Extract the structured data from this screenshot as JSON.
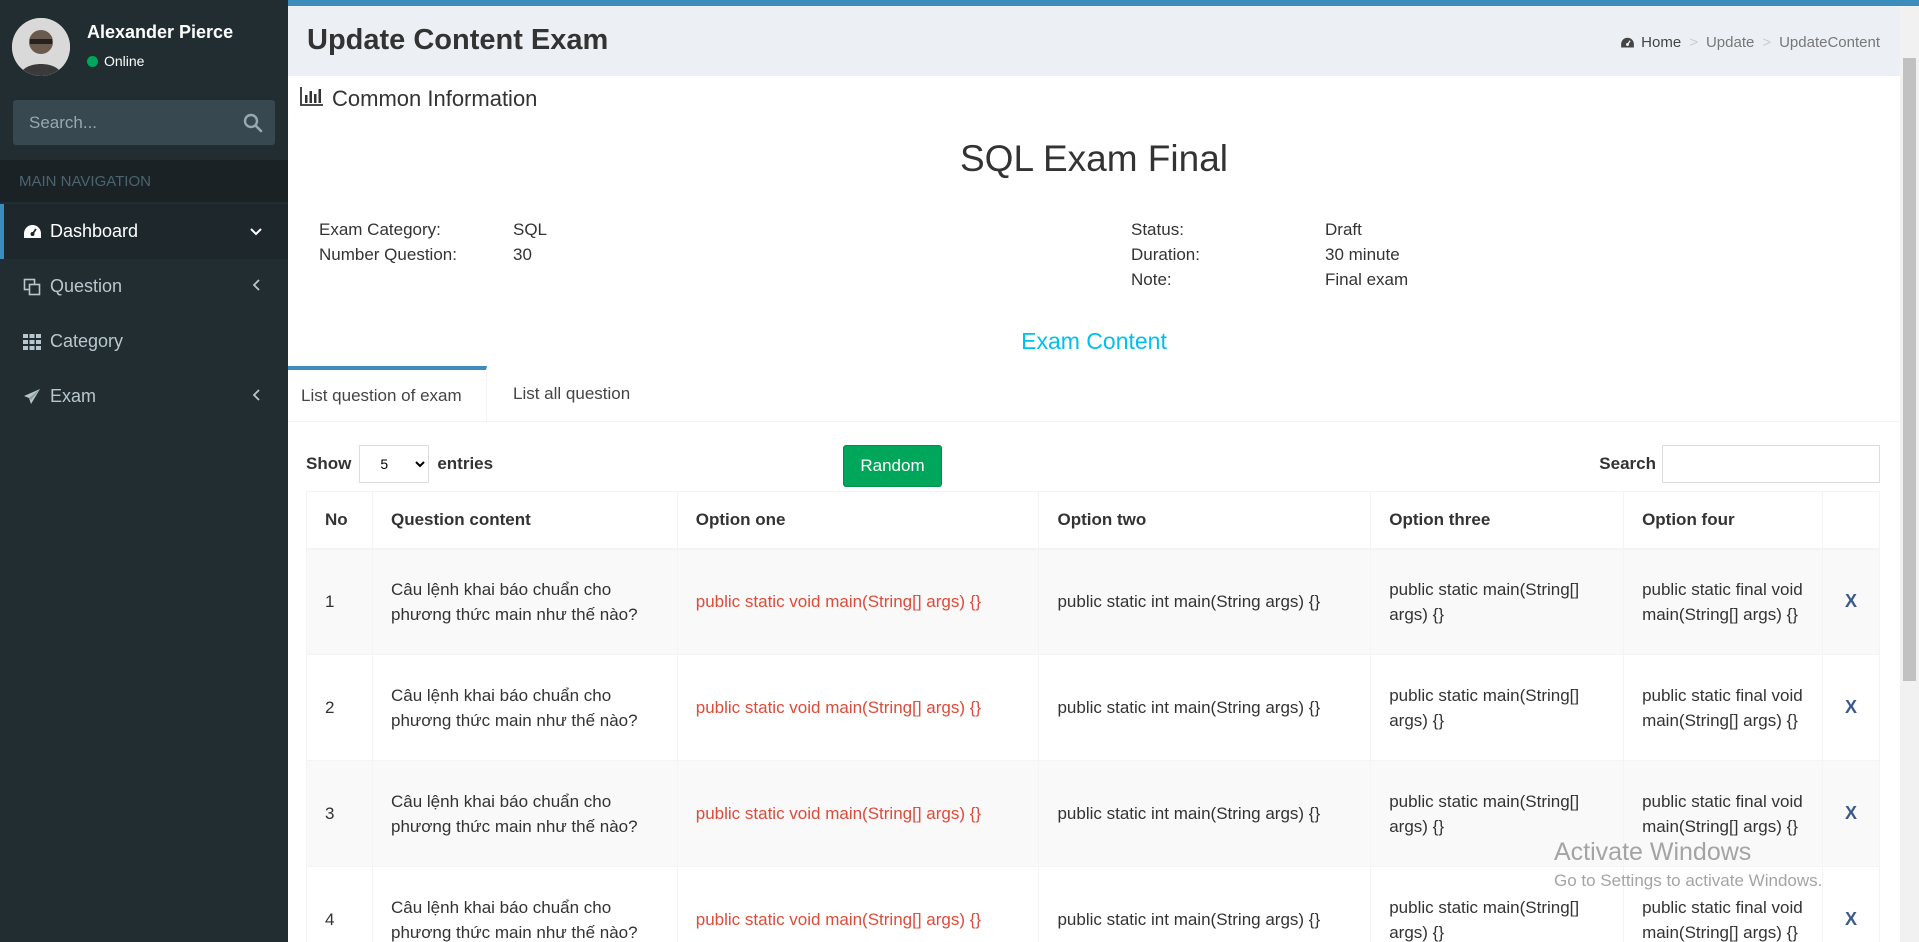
{
  "sidebar": {
    "user_name": "Alexander Pierce",
    "user_status": "Online",
    "search_placeholder": "Search...",
    "nav_header": "MAIN NAVIGATION",
    "items": [
      {
        "label": "Dashboard",
        "icon": "dashboard-icon",
        "arrow": "chevron-down"
      },
      {
        "label": "Question",
        "icon": "copy-icon",
        "arrow": "chevron-left"
      },
      {
        "label": "Category",
        "icon": "grid-icon",
        "arrow": ""
      },
      {
        "label": "Exam",
        "icon": "paper-plane-icon",
        "arrow": "chevron-left"
      }
    ]
  },
  "header": {
    "title": "Update Content Exam",
    "breadcrumb": [
      "Home",
      "Update",
      "UpdateContent"
    ]
  },
  "box": {
    "title": "Common Information",
    "exam_title": "SQL Exam Final",
    "left_info": [
      {
        "key": "Exam Category:",
        "value": "SQL"
      },
      {
        "key": "Number Question:",
        "value": "30"
      }
    ],
    "right_info": [
      {
        "key": "Status:",
        "value": "Draft"
      },
      {
        "key": "Duration:",
        "value": "30 minute"
      },
      {
        "key": "Note:",
        "value": "Final exam"
      }
    ],
    "section_title": "Exam Content",
    "tabs": [
      "List question of exam",
      "List all question"
    ]
  },
  "datatable": {
    "show_label": "Show",
    "entries_value": "5",
    "entries_label": "entries",
    "random_label": "Random",
    "search_label": "Search",
    "columns": [
      "No",
      "Question content",
      "Option one",
      "Option two",
      "Option three",
      "Option four",
      ""
    ],
    "rows": [
      {
        "no": "1",
        "content": "Câu lệnh khai báo chuẩn cho phương thức main như thế nào?",
        "opt1": "public static void main(String[] args) {}",
        "opt2": "public static int main(String args) {}",
        "opt3": "public static main(String[] args) {}",
        "opt4": "public static final void main(String[] args) {}",
        "del": "X"
      },
      {
        "no": "2",
        "content": "Câu lệnh khai báo chuẩn cho phương thức main như thế nào?",
        "opt1": "public static void main(String[] args) {}",
        "opt2": "public static int main(String args) {}",
        "opt3": "public static main(String[] args) {}",
        "opt4": "public static final void main(String[] args) {}",
        "del": "X"
      },
      {
        "no": "3",
        "content": "Câu lệnh khai báo chuẩn cho phương thức main như thế nào?",
        "opt1": "public static void main(String[] args) {}",
        "opt2": "public static int main(String args) {}",
        "opt3": "public static main(String[] args) {}",
        "opt4": "public static final void main(String[] args) {}",
        "del": "X"
      },
      {
        "no": "4",
        "content": "Câu lệnh khai báo chuẩn cho phương thức main như thế nào?",
        "opt1": "public static void main(String[] args) {}",
        "opt2": "public static int main(String args) {}",
        "opt3": "public static main(String[] args) {}",
        "opt4": "public static final void main(String[] args) {}",
        "del": "X"
      }
    ]
  },
  "watermark": {
    "line1": "Activate Windows",
    "line2": "Go to Settings to activate Windows."
  },
  "colors": {
    "sidebar_bg": "#222d32",
    "accent": "#3c8dbc",
    "success": "#00a65a",
    "correct_answer": "#dd4b39",
    "section_title": "#00c0ef"
  }
}
